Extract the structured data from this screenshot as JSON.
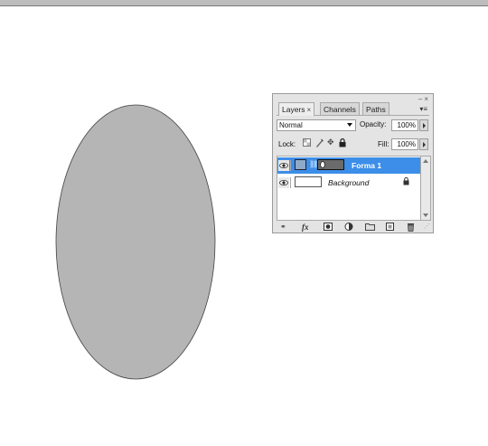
{
  "panel": {
    "tabs": [
      {
        "label": "Layers",
        "close": "×",
        "active": true
      },
      {
        "label": "Channels",
        "active": false
      },
      {
        "label": "Paths",
        "active": false
      }
    ],
    "window_controls": "–×",
    "blend_mode": "Normal",
    "opacity_label": "Opacity:",
    "opacity_value": "100%",
    "lock_label": "Lock:",
    "fill_label": "Fill:",
    "fill_value": "100%",
    "layers": [
      {
        "name": "Forma 1",
        "selected": true,
        "visible": true
      },
      {
        "name": "Background",
        "selected": false,
        "visible": true,
        "locked": true
      }
    ],
    "footer_icons": [
      "link-icon",
      "fx-icon",
      "mask-icon",
      "adjustment-icon",
      "group-folder-icon",
      "new-layer-icon",
      "trash-icon"
    ],
    "fx_label": "fx"
  },
  "canvas": {
    "shape": "ellipse",
    "shape_fill": "#b5b5b5",
    "shape_stroke": "#444444"
  },
  "colors": {
    "selection": "#3d8ee8",
    "panel_bg": "#e4e4e4"
  }
}
